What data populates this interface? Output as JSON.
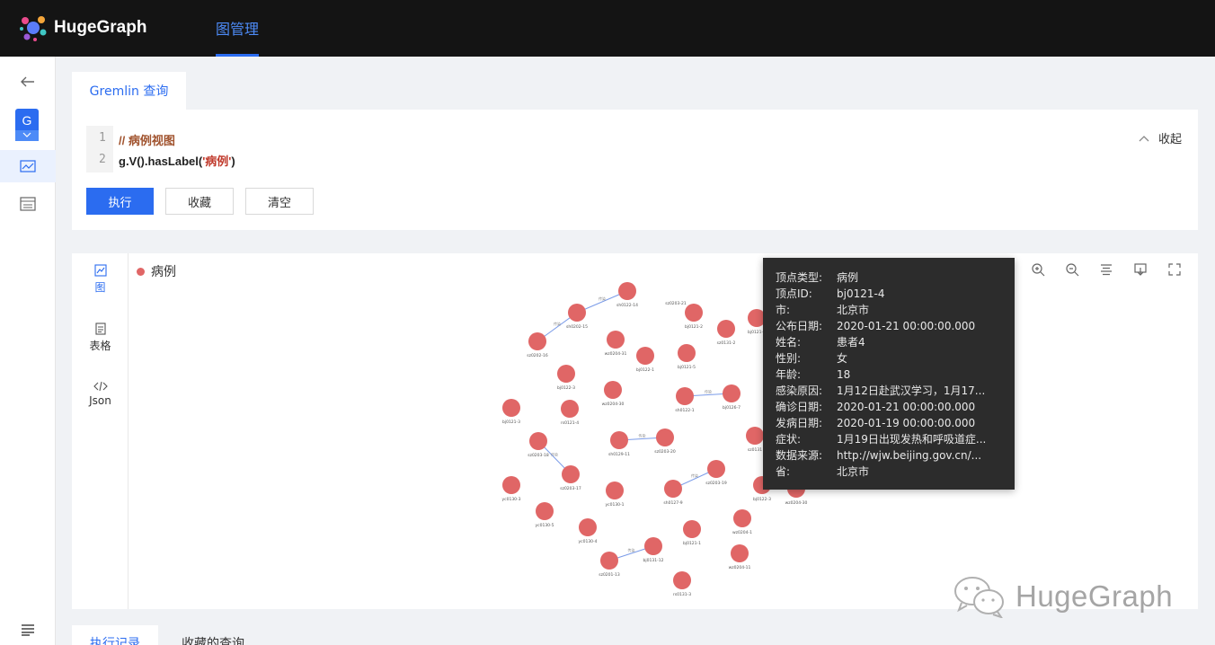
{
  "app": {
    "name": "HugeGraph"
  },
  "topnav": {
    "active_tab": "图管理"
  },
  "sidebar": {
    "graph_badge": "G"
  },
  "query": {
    "tab_label": "Gremlin 查询",
    "lines": [
      {
        "num": "1",
        "text": "// 病例视图"
      },
      {
        "num": "2",
        "prefix": "g.V().hasLabel(",
        "string": "'病例'",
        "suffix": ")"
      }
    ],
    "collapse_label": "收起",
    "buttons": {
      "execute": "执行",
      "favorite": "收藏",
      "clear": "清空"
    }
  },
  "result": {
    "views": [
      {
        "label": "图",
        "active": true
      },
      {
        "label": "表格",
        "active": false
      },
      {
        "label": "Json",
        "active": false
      }
    ],
    "legend": {
      "label": "病例",
      "color": "#e06666"
    },
    "node_color": "#e06666",
    "edge_color": "#7a9be8",
    "graph": {
      "nodes": [
        {
          "id": "n1",
          "label": "sh0122-14"
        },
        {
          "id": "n2",
          "label": "sz0203-21"
        },
        {
          "id": "n3",
          "label": "sh0202-15"
        },
        {
          "id": "n4",
          "label": "bj0121-2"
        },
        {
          "id": "n5",
          "label": "sz0202-16"
        },
        {
          "id": "n6",
          "label": "sz0131-2"
        },
        {
          "id": "n7",
          "label": "bj0121-4"
        },
        {
          "id": "n8",
          "label": "wz0204-31"
        },
        {
          "id": "n9",
          "label": "bj0122-1"
        },
        {
          "id": "n10",
          "label": "bj0121-5"
        },
        {
          "id": "n11",
          "label": "bj0122-3"
        },
        {
          "id": "n12",
          "label": "wz0204-30"
        },
        {
          "id": "n13",
          "label": "sh0122-1"
        },
        {
          "id": "n14",
          "label": "bj0126-7"
        },
        {
          "id": "n15",
          "label": "bj0121-3"
        },
        {
          "id": "n16",
          "label": "rs0121-4"
        },
        {
          "id": "n17",
          "label": "sz0203-18"
        },
        {
          "id": "n18",
          "label": "sh0129-11"
        },
        {
          "id": "n19",
          "label": "sz0203-20"
        },
        {
          "id": "n20",
          "label": "sz0131"
        },
        {
          "id": "n21",
          "label": "sz0203-17"
        },
        {
          "id": "n22",
          "label": "sz0203-19"
        },
        {
          "id": "n23",
          "label": "yc0130-3"
        },
        {
          "id": "n24",
          "label": "yc0130-1"
        },
        {
          "id": "n25",
          "label": "sh0127-9"
        },
        {
          "id": "n26",
          "label": "bj0122-3"
        },
        {
          "id": "n27",
          "label": "wz0204-30"
        },
        {
          "id": "n28",
          "label": "yc0130-5"
        },
        {
          "id": "n29",
          "label": "yc0130-4"
        },
        {
          "id": "n30",
          "label": "bj0121-1"
        },
        {
          "id": "n31",
          "label": "wz0204-1"
        },
        {
          "id": "n32",
          "label": "bj0131-12"
        },
        {
          "id": "n33",
          "label": "sz0201-13"
        },
        {
          "id": "n34",
          "label": "wz0204-11"
        },
        {
          "id": "n35",
          "label": "rs0131-3"
        }
      ],
      "edges": [
        {
          "from": "n3",
          "to": "n1",
          "label": "传染"
        },
        {
          "from": "n5",
          "to": "n3",
          "label": "传染"
        },
        {
          "from": "n13",
          "to": "n14",
          "label": "传染"
        },
        {
          "from": "n17",
          "to": "n21",
          "label": "传染"
        },
        {
          "from": "n18",
          "to": "n19",
          "label": "传染"
        },
        {
          "from": "n25",
          "to": "n22",
          "label": "传染"
        },
        {
          "from": "n33",
          "to": "n32",
          "label": "传染"
        }
      ]
    }
  },
  "tooltip": {
    "rows": [
      {
        "key": "顶点类型:",
        "value": "病例"
      },
      {
        "key": "顶点ID:",
        "value": "bj0121-4"
      },
      {
        "key": "市:",
        "value": "北京市"
      },
      {
        "key": "公布日期:",
        "value": "2020-01-21 00:00:00.000"
      },
      {
        "key": "姓名:",
        "value": "患者4"
      },
      {
        "key": "性别:",
        "value": "女"
      },
      {
        "key": "年龄:",
        "value": "18"
      },
      {
        "key": "感染原因:",
        "value": "1月12日赴武汉学习，1月17..."
      },
      {
        "key": "确诊日期:",
        "value": "2020-01-21 00:00:00.000"
      },
      {
        "key": "发病日期:",
        "value": "2020-01-19 00:00:00.000"
      },
      {
        "key": "症状:",
        "value": "1月19日出现发热和呼吸道症..."
      },
      {
        "key": "数据来源:",
        "value": "http://wjw.beijing.gov.cn/..."
      },
      {
        "key": "省:",
        "value": "北京市"
      }
    ]
  },
  "bottom_tabs": [
    {
      "label": "执行记录",
      "active": true
    },
    {
      "label": "收藏的查询",
      "active": false
    }
  ],
  "watermark": {
    "text": "HugeGraph"
  }
}
